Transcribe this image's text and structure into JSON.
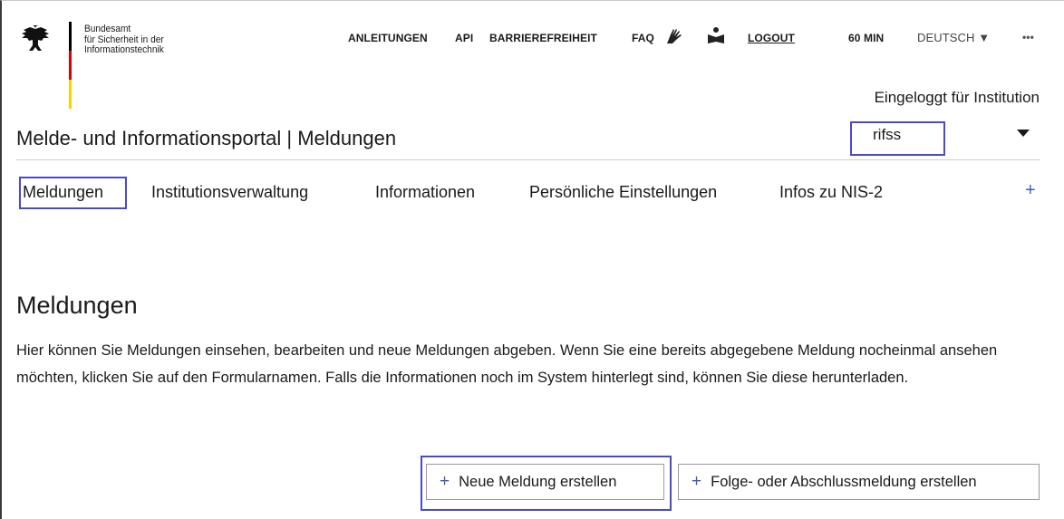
{
  "header": {
    "org_lines": [
      "Bundesamt",
      "für Sicherheit in der",
      "Informationstechnik"
    ],
    "top_nav": {
      "anleitungen": "ANLEITUNGEN",
      "api": "API",
      "barrierefreiheit": "BARRIEREFREIHEIT",
      "faq": "FAQ",
      "logout": "LOGOUT",
      "session": "60 MIN",
      "language": "DEUTSCH ▼",
      "more": "•••"
    },
    "logged_in_label": "Eingeloggt für Institution",
    "institution_value": "rifss",
    "portal_title": "Melde- und Informationsportal | Meldungen"
  },
  "main_nav": {
    "items": [
      "Meldungen",
      "Institutionsverwaltung",
      "Informationen",
      "Persönliche Einstellungen",
      "Infos zu NIS-2"
    ],
    "expand": "+"
  },
  "content": {
    "heading": "Meldungen",
    "description": "Hier können Sie Meldungen einsehen, bearbeiten und neue Meldungen abgeben. Wenn Sie eine bereits abgegebene Meldung nocheinmal ansehen möchten, klicken Sie auf den Formularnamen. Falls die Informationen noch im System hinterlegt sind, können Sie diese herunterladen.",
    "buttons": {
      "new_label": "Neue Meldung erstellen",
      "followup_label": "Folge- oder Abschlussmeldung erstellen",
      "plus": "+"
    }
  },
  "icons": {
    "eagle": "federal-eagle-icon",
    "sign_language": "sign-language-icon",
    "easy_language": "easy-language-icon",
    "caret": "caret-down-icon"
  },
  "colors": {
    "highlight_box": "#4a4ac8",
    "accent_blue": "#3d5ec0",
    "flag_black": "#000000",
    "flag_red": "#dd0000",
    "flag_gold": "#ffce00"
  }
}
